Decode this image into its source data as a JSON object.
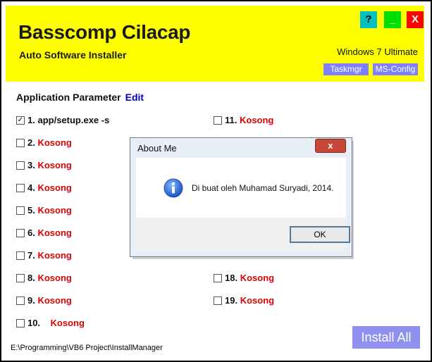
{
  "header": {
    "title": "Basscomp Cilacap",
    "subtitle": "Auto Software Installer",
    "os": "Windows 7 Ultimate",
    "taskmgr": "Taskmgr",
    "msconfig": "MS-Config",
    "help": "?",
    "minimize": "_",
    "close": "X"
  },
  "params": {
    "title": "Application Parameter",
    "edit": "Edit",
    "left": [
      {
        "num": "1.",
        "val": "app/setup.exe -s",
        "checked": true
      },
      {
        "num": "2.",
        "val": "Kosong"
      },
      {
        "num": "3.",
        "val": "Kosong"
      },
      {
        "num": "4.",
        "val": "Kosong"
      },
      {
        "num": "5.",
        "val": "Kosong"
      },
      {
        "num": "6.",
        "val": "Kosong"
      },
      {
        "num": "7.",
        "val": "Kosong"
      },
      {
        "num": "8.",
        "val": "Kosong"
      },
      {
        "num": "9.",
        "val": "Kosong"
      },
      {
        "num": "10.",
        "val": "Kosong"
      }
    ],
    "right": [
      {
        "num": "11.",
        "val": "Kosong"
      },
      {
        "num": "18.",
        "val": "Kosong"
      },
      {
        "num": "19.",
        "val": "Kosong"
      }
    ]
  },
  "install_label": "Install All",
  "status_path": "E:\\Programming\\VB6 Project\\InstallManager",
  "dialog": {
    "title": "About Me",
    "close": "x",
    "message": "Di buat oleh Muhamad Suryadi, 2014.",
    "ok": "OK"
  }
}
